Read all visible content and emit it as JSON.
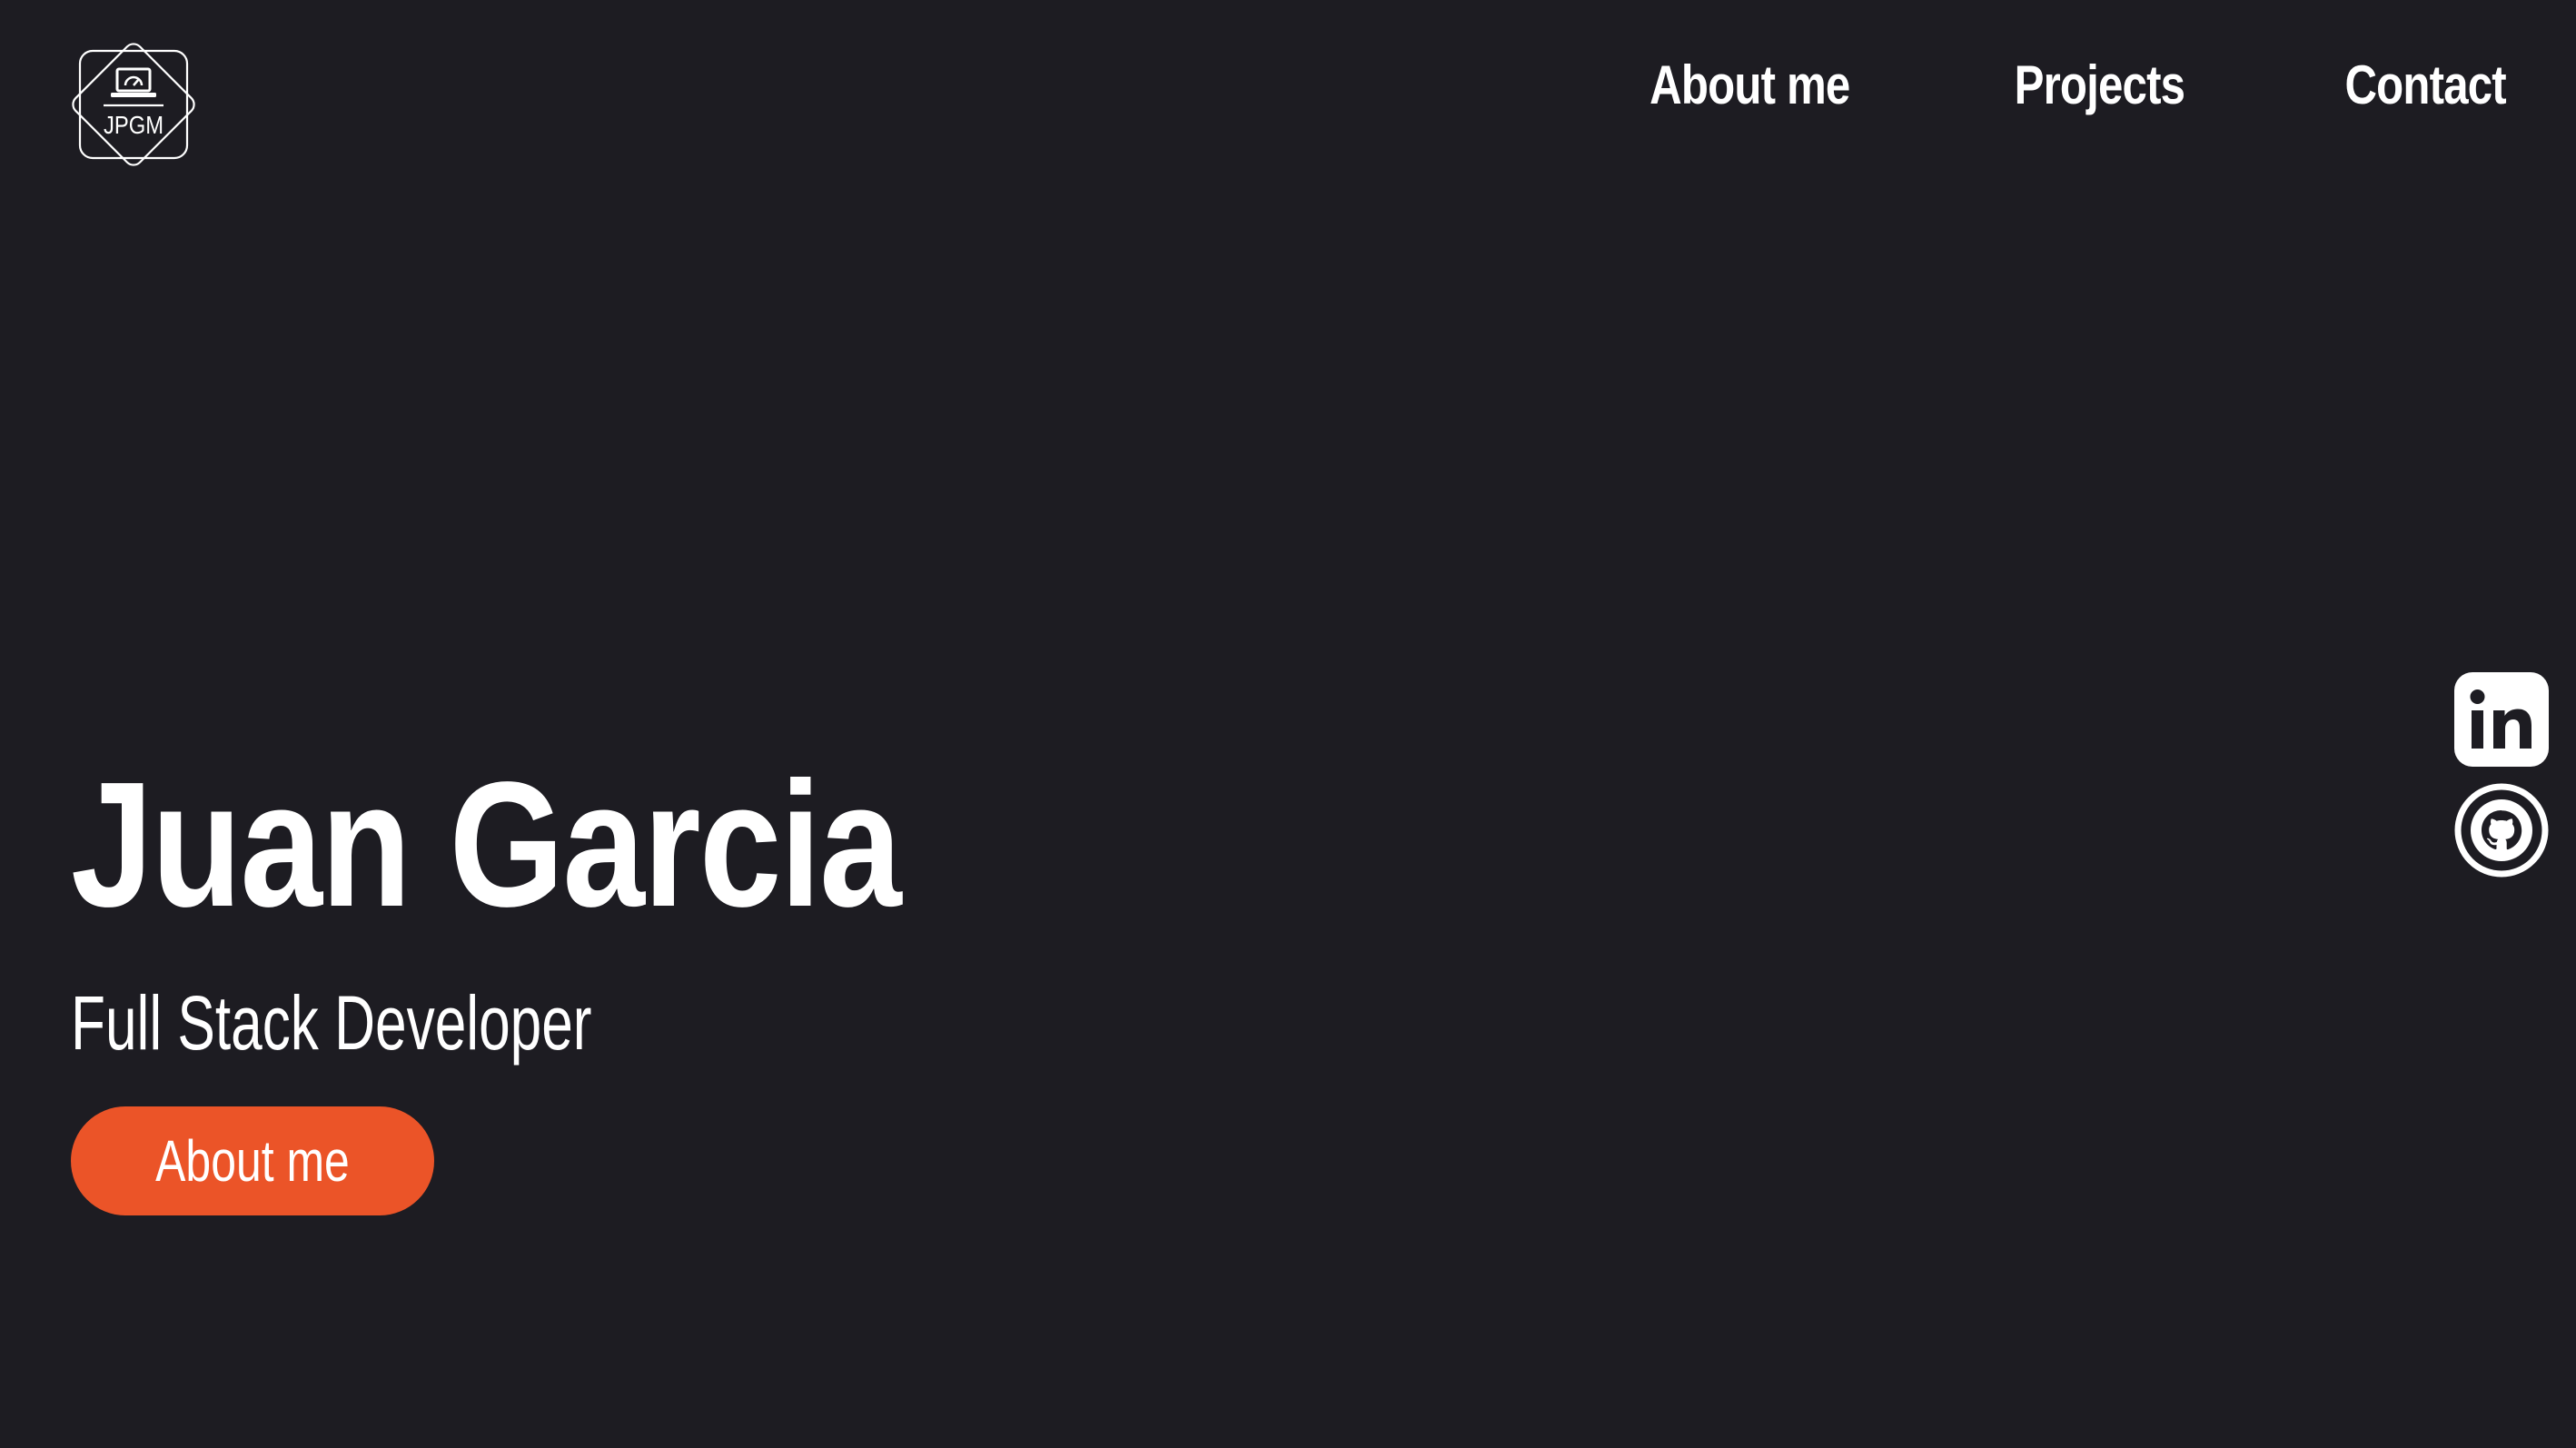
{
  "header": {
    "logo": {
      "text": "JPGM",
      "icon": "laptop-icon"
    },
    "nav": [
      {
        "label": "About me"
      },
      {
        "label": "Projects"
      },
      {
        "label": "Contact"
      }
    ]
  },
  "hero": {
    "name": "Juan Garcia",
    "role": "Full Stack Developer",
    "cta_label": "About me"
  },
  "social": [
    {
      "icon": "linkedin-icon",
      "name": "LinkedIn"
    },
    {
      "icon": "github-icon",
      "name": "GitHub"
    }
  ],
  "colors": {
    "background": "#1d1c22",
    "text": "#ffffff",
    "accent": "#eb5428"
  }
}
